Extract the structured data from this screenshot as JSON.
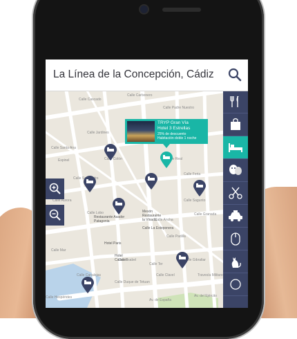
{
  "search": {
    "query": "La Línea de la Concepción, Cádiz"
  },
  "callout": {
    "title_line1": "TRYP Gran Vía",
    "title_line2": "Hotel 3 Estrellas",
    "discount": "25% de descuento",
    "offer": "Habitación doble 1 noche"
  },
  "map": {
    "streets": [
      "Calle Cascado",
      "Calle Carbonero",
      "Calle Santa Ana",
      "Calle Padre Nuestro",
      "Calle Sol",
      "Calle Jardines",
      "Espinel",
      "Calle San Pedro",
      "Calle Colón",
      "Calle Real",
      "Calle Clavel",
      "Calle Feria",
      "Calle Aurora",
      "Calle Sagunto",
      "Calle Granada",
      "Calle Ancha",
      "Calle Lobo",
      "Calle Padilla",
      "Calle Mar",
      "Calle Ter",
      "Calle Isabel",
      "Calle Gibraltar",
      "Calle Canalejas",
      "Calle Duque de Tetuan",
      "Calle Clavel",
      "Av. de España",
      "Av. del Ejército",
      "Travesía Militares",
      "Calle Hespérides"
    ],
    "pois": [
      "Hotel Paris",
      "Restaurante Asador Patagonia",
      "Mesón Restaurante la Vinada",
      "Hotel Carlos II",
      "Calle La Esteponera"
    ]
  },
  "categories": [
    {
      "icon": "restaurant-icon",
      "active": false
    },
    {
      "icon": "shopping-bag-icon",
      "active": false
    },
    {
      "icon": "hotel-bed-icon",
      "active": true
    },
    {
      "icon": "theater-masks-icon",
      "active": false
    },
    {
      "icon": "beauty-scissors-icon",
      "active": false
    },
    {
      "icon": "taxi-icon",
      "active": false
    },
    {
      "icon": "mouse-icon",
      "active": false
    },
    {
      "icon": "pet-icon",
      "active": false
    },
    {
      "icon": "more-icon",
      "active": false
    }
  ],
  "colors": {
    "navy": "#3b4466",
    "teal": "#19b6a6",
    "map_bg": "#e8e4dc"
  }
}
